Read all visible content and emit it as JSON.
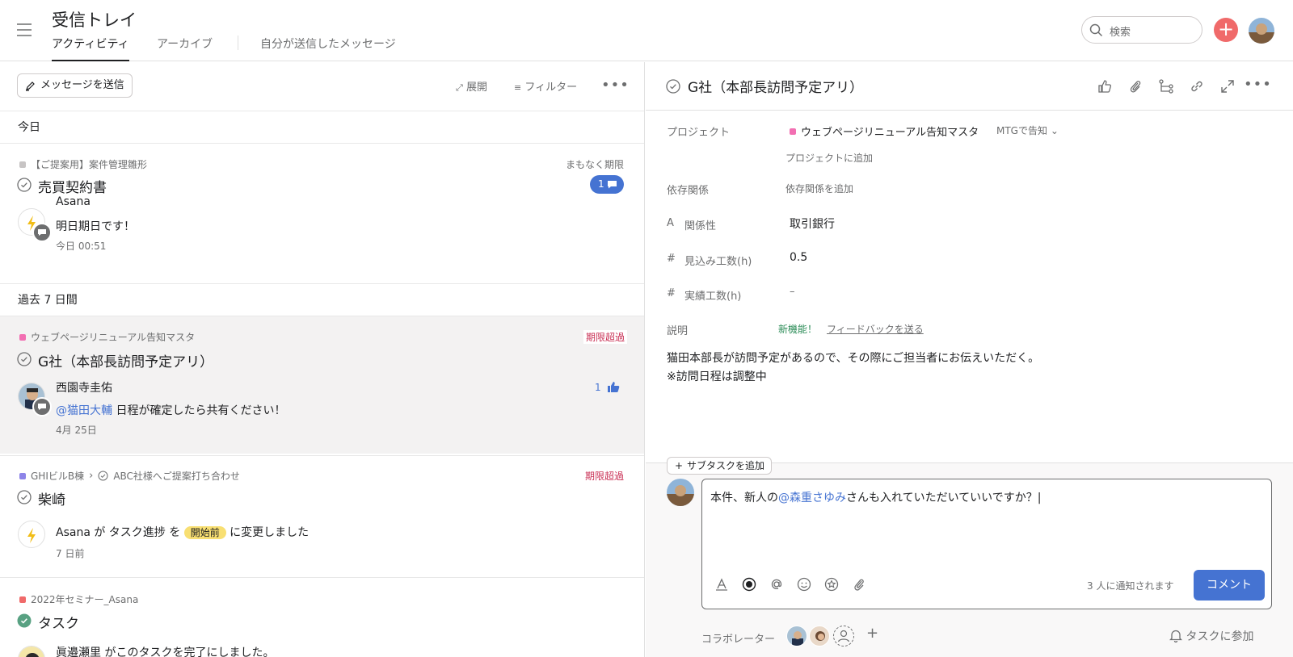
{
  "header": {
    "title": "受信トレイ",
    "tabs": [
      {
        "label": "アクティビティ",
        "active": true
      },
      {
        "label": "アーカイブ",
        "active": false
      },
      {
        "label": "自分が送信したメッセージ",
        "active": false
      }
    ],
    "search_placeholder": "検索",
    "add_icon": "plus-icon",
    "accent_color": "#f06a6a"
  },
  "left": {
    "send_message": "メッセージを送信",
    "expand": "展開",
    "filter": "フィルター",
    "sections": {
      "today": "今日",
      "past_week": "過去 7 日間"
    },
    "items": [
      {
        "project": "【ご提案用】案件管理雛形",
        "status": "まもなく期限",
        "task": "売買契約書",
        "comment_count": "1",
        "actor": "Asana",
        "message": "明日期日です！",
        "time": "今日 00:51"
      },
      {
        "project": "ウェブページリニューアル告知マスタ",
        "status": "期限超過",
        "task": "G社（本部長訪問予定アリ）",
        "actor": "西園寺圭佑",
        "mention": "@猫田大輔",
        "message": " 日程が確定したら共有ください！",
        "like_count": "1",
        "time": "4月 25日"
      },
      {
        "project": "GHIビルB棟",
        "parent": "ABC社様へご提案打ち合わせ",
        "status": "期限超過",
        "task": "柴崎",
        "actor": "Asana",
        "msg_a": " が タスク進捗 を ",
        "tag": "開始前",
        "msg_b": " に変更しました",
        "time": "7 日前"
      },
      {
        "project": "2022年セミナー_Asana",
        "task": "タスク",
        "message": "眞邉瀬里 がこのタスクを完了にしました。"
      }
    ]
  },
  "detail": {
    "title": "G社（本部長訪問予定アリ）",
    "fields": {
      "project_label": "プロジェクト",
      "project_value": "ウェブページリニューアル告知マスタ",
      "section_value": "MTGで告知",
      "add_project": "プロジェクトに追加",
      "dependency_label": "依存関係",
      "dependency_value": "依存関係を追加",
      "relation_label": "関係性",
      "relation_value": "取引銀行",
      "estimate_label": "見込み工数(h)",
      "estimate_value": "0.5",
      "actual_label": "実績工数(h)",
      "actual_value": "–",
      "description_label": "説明",
      "new_feature": "新機能！",
      "feedback": "フィードバックを送る"
    },
    "description": [
      "猫田本部長が訪問予定があるので、その際にご担当者にお伝えいただく。",
      "※訪問日程は調整中"
    ],
    "add_subtask": "サブタスクを追加",
    "comment": {
      "text_a": "本件、新人の",
      "mention": "@森重さゆみ",
      "text_b": "さんも入れていただいていいですか？",
      "notify": "3 人に通知されます",
      "button": "コメント"
    },
    "collaborators_label": "コラボレーター",
    "join_task": "タスクに参加"
  }
}
